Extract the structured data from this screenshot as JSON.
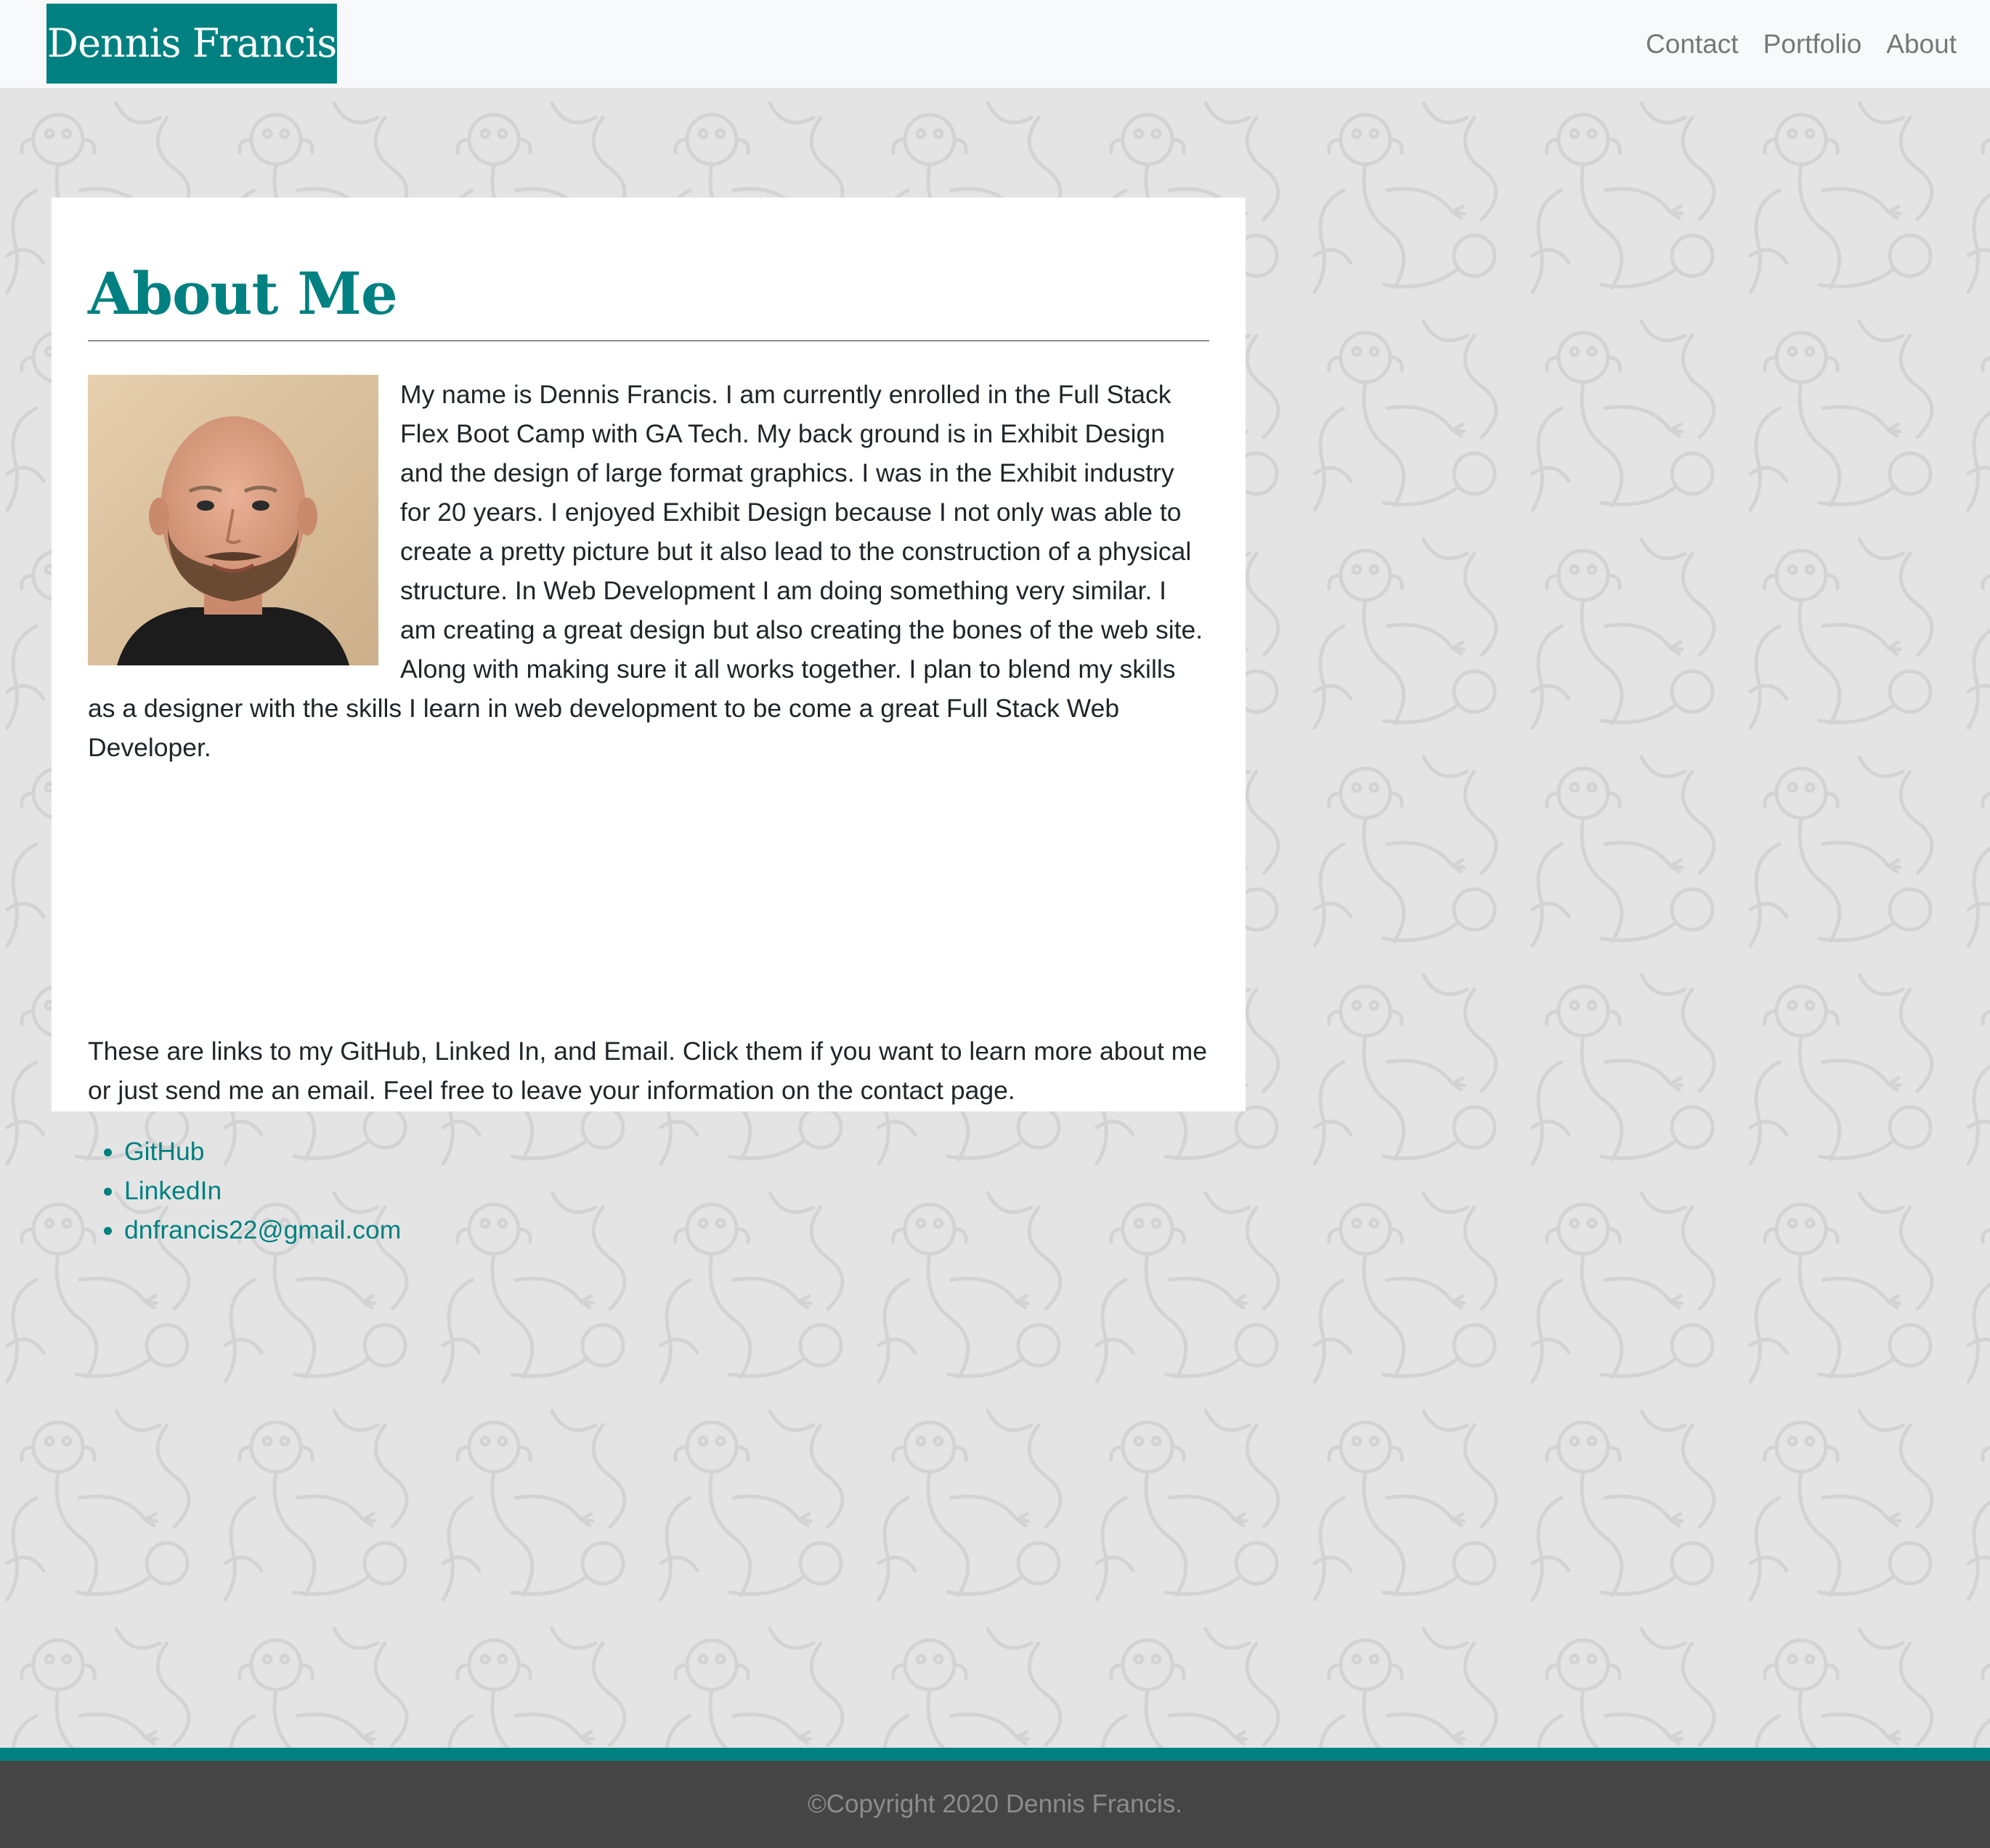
{
  "navbar": {
    "brand": "Dennis Francis",
    "links": [
      {
        "label": "Contact"
      },
      {
        "label": "Portfolio"
      },
      {
        "label": "About"
      }
    ]
  },
  "about": {
    "title": "About Me",
    "portrait_alt": "Photo of Dennis Francis",
    "bio": "My name is Dennis Francis. I am currently enrolled in the Full Stack Flex Boot Camp with GA Tech. My back ground is in Exhibit Design and the design of large format graphics. I was in the Exhibit industry for 20 years. I enjoyed Exhibit Design because I not only was able to create a pretty picture but it also lead to the construction of a physical structure. In Web Development I am doing something very similar. I am creating a great design but also creating the bones of the web site. Along with making sure it all works together. I plan to blend my skills as a designer with the skills I learn in web development to be come a great Full Stack Web Developer.",
    "links_intro": "These are links to my GitHub, Linked In, and Email. Click them if you want to learn more about me or just send me an email. Feel free to leave your information on the contact page.",
    "links": [
      {
        "label": "GitHub"
      },
      {
        "label": "LinkedIn"
      },
      {
        "label": "dnfrancis22@gmail.com"
      }
    ]
  },
  "footer": {
    "copyright": "©Copyright 2020 Dennis Francis."
  },
  "colors": {
    "accent": "#008080",
    "footer_bg": "#454545",
    "page_bg": "#e4e4e4"
  }
}
